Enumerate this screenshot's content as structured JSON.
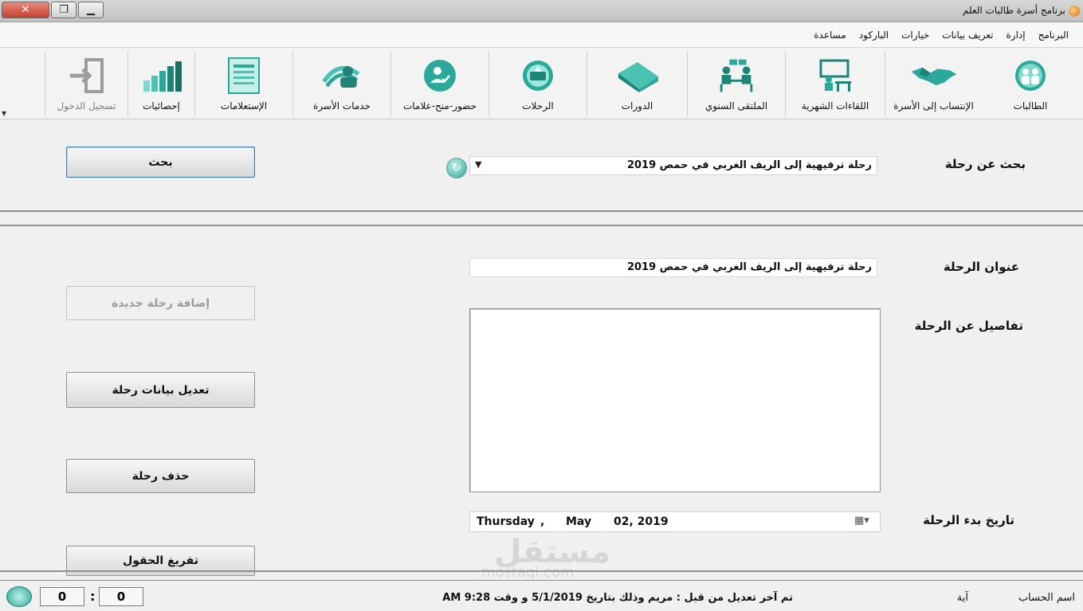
{
  "window": {
    "title": "برنامج أسرة طالبات العلم",
    "min_label": "▁",
    "restore_label": "❐",
    "close_label": "✕"
  },
  "menu": [
    "البرنامج",
    "إدارة",
    "تعريف بيانات",
    "خيارات",
    "الباركود",
    "مساعدة"
  ],
  "toolbar": {
    "items": [
      {
        "label": "الطالبات",
        "icon": "students-icon"
      },
      {
        "label": "الإنتساب إلى الأسرة",
        "icon": "handshake-icon"
      },
      {
        "label": "اللقاءات الشهرية",
        "icon": "lecture-icon"
      },
      {
        "label": "الملتقى السنوي",
        "icon": "meeting-icon"
      },
      {
        "label": "الدورات",
        "icon": "books-icon"
      },
      {
        "label": "الرحلات",
        "icon": "trips-icon"
      },
      {
        "label": "حضور-منح-علامات",
        "icon": "attendance-icon"
      },
      {
        "label": "خدمات الأسرة",
        "icon": "services-icon"
      },
      {
        "label": "الإستعلامات",
        "icon": "queries-icon"
      },
      {
        "label": "إحصائيات",
        "icon": "stats-icon"
      },
      {
        "label": "تسجيل الدخول",
        "icon": "login-icon",
        "disabled": true
      }
    ]
  },
  "search": {
    "label": "بحث عن رحلة",
    "selected": "رحلة ترفيهية إلى الريف الغربي في حمص 2019",
    "button": "بحث"
  },
  "form": {
    "title_label": "عنوان الرحلة",
    "title_value": "رحلة ترفيهية إلى الريف الغربي في حمص 2019",
    "details_label": "تفاصيل عن الرحلة",
    "details_value": "",
    "date_label": "تاريخ بدء الرحلة",
    "date": {
      "weekday": "Thursday",
      "sep": ",",
      "month": "May",
      "day_year": "02, 2019"
    }
  },
  "actions": {
    "add": "إضافة رحلة جديدة",
    "edit": "تعديل بيانات رحلة",
    "delete": "حذف رحلة",
    "clear": "تفريغ الحقول"
  },
  "status": {
    "account_label": "اسم الحساب",
    "account_value": "آية",
    "last_edit": "تم آخر تعديل من قبل  : مريم وذلك بتاريخ  5/1/2019  و وقت 9:28 AM",
    "counter_left": "0",
    "counter_right": "0",
    "colon": ":"
  },
  "watermark": {
    "arabic": "مستقل",
    "latin": "mostaql.com"
  },
  "colors": {
    "accent": "#2aa89a",
    "background": "#f0f0f0"
  }
}
